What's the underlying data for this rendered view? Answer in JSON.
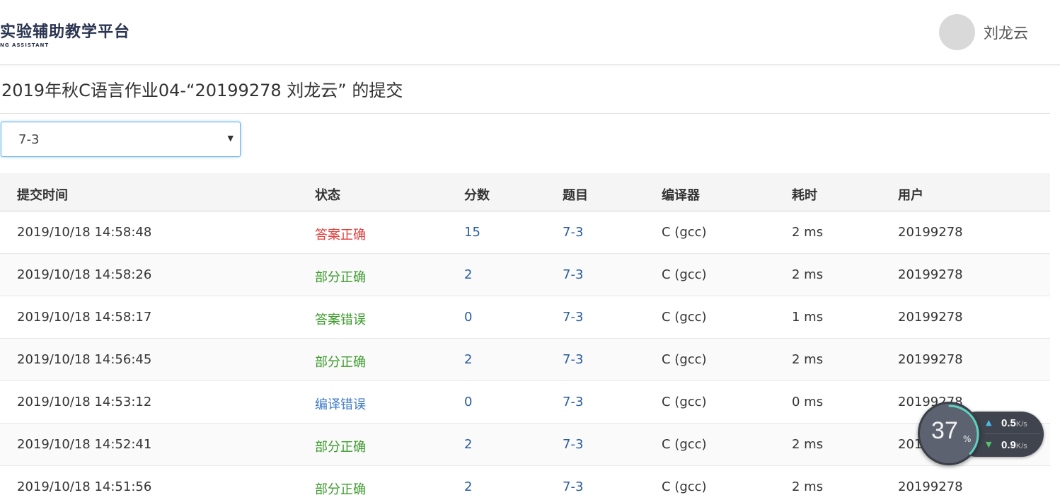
{
  "header": {
    "logo_title": "实验辅助教学平台",
    "logo_subtitle": "NG ASSISTANT",
    "user_name": "刘龙云"
  },
  "page": {
    "title": "2019年秋C语言作业04-“20199278 刘龙云” 的提交"
  },
  "problem_select": {
    "selected": "7-3"
  },
  "table": {
    "headers": [
      "提交时间",
      "状态",
      "分数",
      "题目",
      "编译器",
      "耗时",
      "用户"
    ],
    "rows": [
      {
        "time": "2019/10/18 14:58:48",
        "status": "答案正确",
        "score": "15",
        "problem": "7-3",
        "compiler": "C (gcc)",
        "duration": "2 ms",
        "user": "20199278"
      },
      {
        "time": "2019/10/18 14:58:26",
        "status": "部分正确",
        "score": "2",
        "problem": "7-3",
        "compiler": "C (gcc)",
        "duration": "2 ms",
        "user": "20199278"
      },
      {
        "time": "2019/10/18 14:58:17",
        "status": "答案错误",
        "score": "0",
        "problem": "7-3",
        "compiler": "C (gcc)",
        "duration": "1 ms",
        "user": "20199278"
      },
      {
        "time": "2019/10/18 14:56:45",
        "status": "部分正确",
        "score": "2",
        "problem": "7-3",
        "compiler": "C (gcc)",
        "duration": "2 ms",
        "user": "20199278"
      },
      {
        "time": "2019/10/18 14:53:12",
        "status": "编译错误",
        "score": "0",
        "problem": "7-3",
        "compiler": "C (gcc)",
        "duration": "0 ms",
        "user": "20199278"
      },
      {
        "time": "2019/10/18 14:52:41",
        "status": "部分正确",
        "score": "2",
        "problem": "7-3",
        "compiler": "C (gcc)",
        "duration": "2 ms",
        "user": "20199278"
      },
      {
        "time": "2019/10/18 14:51:56",
        "status": "部分正确",
        "score": "2",
        "problem": "7-3",
        "compiler": "C (gcc)",
        "duration": "2 ms",
        "user": "20199278"
      }
    ]
  },
  "status_colors": {
    "答案正确": "#e0403d",
    "部分正确": "#3b9a2b",
    "答案错误": "#3b9a2b",
    "编译错误": "#3d79c8"
  },
  "net_widget": {
    "percent": "37",
    "percent_sign": "%",
    "upload": "0.5",
    "download": "0.9",
    "unit": "K/s"
  }
}
